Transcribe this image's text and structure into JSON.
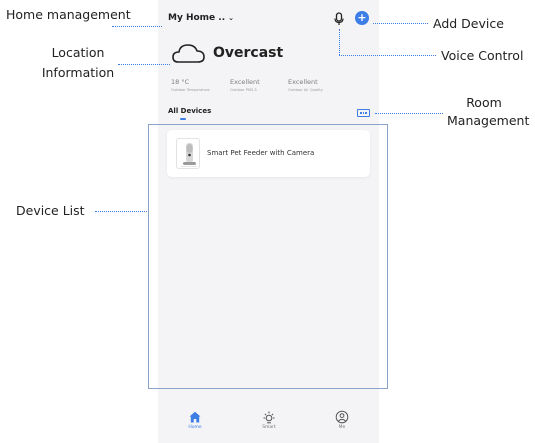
{
  "app": {
    "home_name": "My Home ..",
    "weather": "Overcast",
    "metrics": [
      {
        "value": "18 °C",
        "label": "Outdoor Temperature"
      },
      {
        "value": "Excellent",
        "label": "Outdoor PM2.5"
      },
      {
        "value": "Excellent",
        "label": "Outdoor Air Quality"
      }
    ],
    "section_label": "All Devices",
    "devices": [
      {
        "name": "Smart Pet Feeder with Camera"
      }
    ],
    "tabs": [
      {
        "label": "Home",
        "icon": "home-icon",
        "active": true
      },
      {
        "label": "Smart",
        "icon": "sun-icon",
        "active": false
      },
      {
        "label": "Me",
        "icon": "profile-icon",
        "active": false
      }
    ],
    "accent_color": "#3d7de6"
  },
  "annotations": {
    "home_management": "Home management",
    "location_line1": "Location",
    "location_line2": "Information",
    "device_list": "Device List",
    "add_device": "Add Device",
    "voice_control": "Voice Control",
    "room_line1": "Room",
    "room_line2": "Management"
  }
}
